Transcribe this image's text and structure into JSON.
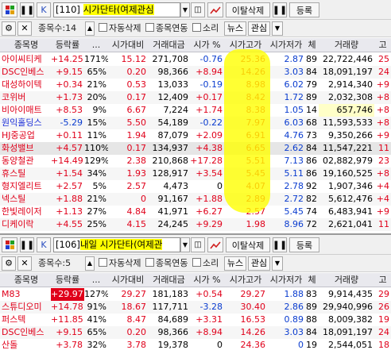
{
  "panel1": {
    "title_prefix": "[110] ",
    "title_highlight": "시가단타(여제관심",
    "title_suffix": "",
    "id_label": "K",
    "exit_delete": "이탈삭제",
    "register": "등록",
    "stock_count_label": "종목수:14",
    "auto_delete": "자동삭제",
    "stock_link": "종목연동",
    "sound": "소리",
    "news": "뉴스",
    "interest": "관심",
    "headers": [
      "종목명",
      "등락률",
      "...",
      "시가대비",
      "거래대금",
      "시가 %",
      "시가고가",
      "시가저가",
      "체",
      "거래량",
      "고"
    ],
    "rows": [
      {
        "name": "아이씨티케",
        "chg": "+14.25",
        "pct": "171%",
        "vsopen": "15.12",
        "amount": "271,708",
        "openpct": "-0.76",
        "hi": "25.36",
        "lo": "2.87",
        "c": "89",
        "vol": "22,722,446",
        "g": "25"
      },
      {
        "name": "DSC인베스",
        "chg": "+9.15",
        "pct": "65%",
        "vsopen": "0.20",
        "amount": "98,366",
        "openpct": "+8.94",
        "hi": "14.26",
        "lo": "3.03",
        "c": "84",
        "vol": "18,091,197",
        "g": "24"
      },
      {
        "name": "대성하이텍",
        "chg": "+0.34",
        "pct": "21%",
        "vsopen": "0.53",
        "amount": "13,033",
        "openpct": "-0.19",
        "hi": "8.98",
        "lo": "6.02",
        "c": "79",
        "vol": "2,914,340",
        "g": "+9"
      },
      {
        "name": "코위버",
        "chg": "+1.73",
        "pct": "20%",
        "vsopen": "0.17",
        "amount": "12,409",
        "openpct": "+0.17",
        "hi": "8.42",
        "lo": "1.72",
        "c": "89",
        "vol": "2,032,308",
        "g": "+8"
      },
      {
        "name": "비아이매트",
        "chg": "+8.53",
        "pct": "9%",
        "vsopen": "6.67",
        "amount": "7,224",
        "openpct": "+1.74",
        "hi": "8.38",
        "lo": "1.05",
        "c": "14",
        "vol": "657,746",
        "g": "+8"
      },
      {
        "name": "원익홀딩스",
        "chg": "-5.29",
        "pct": "15%",
        "vsopen": "5.50",
        "amount": "54,189",
        "openpct": "-0.22",
        "hi": "7.97",
        "lo": "6.03",
        "c": "68",
        "vol": "11,593,533",
        "g": "+8"
      },
      {
        "name": "HJ중공업",
        "chg": "+0.11",
        "pct": "11%",
        "vsopen": "1.94",
        "amount": "87,079",
        "openpct": "+2.09",
        "hi": "6.91",
        "lo": "4.76",
        "c": "73",
        "vol": "9,350,266",
        "g": "+9"
      },
      {
        "name": "화성밸브",
        "chg": "+4.57",
        "pct": "110%",
        "vsopen": "0.17",
        "amount": "134,937",
        "openpct": "+4.38",
        "hi": "6.65",
        "lo": "2.62",
        "c": "84",
        "vol": "11,547,221",
        "g": "11"
      },
      {
        "name": "동양철관",
        "chg": "+14.49",
        "pct": "129%",
        "vsopen": "2.38",
        "amount": "210,868",
        "openpct": "+17.28",
        "hi": "5.51",
        "lo": "7.13",
        "c": "86",
        "vol": "02,882,979",
        "g": "23"
      },
      {
        "name": "휴스틸",
        "chg": "+1.54",
        "pct": "34%",
        "vsopen": "1.93",
        "amount": "128,917",
        "openpct": "+3.54",
        "hi": "5.45",
        "lo": "5.11",
        "c": "86",
        "vol": "19,160,525",
        "g": "+8"
      },
      {
        "name": "형지엘리트",
        "chg": "+2.57",
        "pct": "5%",
        "vsopen": "2.57",
        "amount": "4,473",
        "openpct": "0",
        "hi": "4.07",
        "lo": "2.78",
        "c": "92",
        "vol": "1,907,346",
        "g": "+4"
      },
      {
        "name": "넥스틸",
        "chg": "+1.88",
        "pct": "21%",
        "vsopen": "0",
        "amount": "91,167",
        "openpct": "+1.88",
        "hi": "2.89",
        "lo": "2.72",
        "c": "82",
        "vol": "5,612,476",
        "g": "+4"
      },
      {
        "name": "한빛레이저",
        "chg": "+1.13",
        "pct": "27%",
        "vsopen": "4.84",
        "amount": "41,971",
        "openpct": "+6.27",
        "hi": "2.57",
        "lo": "5.45",
        "c": "74",
        "vol": "6,483,941",
        "g": "+9"
      },
      {
        "name": "디케이락",
        "chg": "+4.55",
        "pct": "25%",
        "vsopen": "4.15",
        "amount": "24,245",
        "openpct": "+9.29",
        "hi": "1.98",
        "lo": "8.96",
        "c": "72",
        "vol": "2,621,041",
        "g": "11"
      }
    ]
  },
  "panel2": {
    "title_prefix": "[106]",
    "title_highlight": "내일 시가단타(여제관",
    "id_label": "K",
    "exit_delete": "이탈삭제",
    "register": "등록",
    "stock_count_label": "종목수:5",
    "auto_delete": "자동삭제",
    "stock_link": "종목연동",
    "sound": "소리",
    "news": "뉴스",
    "interest": "관심",
    "headers": [
      "종목명",
      "등락률",
      "...",
      "시가대비",
      "거래대금",
      "시가 %",
      "시가고가",
      "시가저가",
      "체",
      "거래량",
      "고"
    ],
    "rows": [
      {
        "name": "M83",
        "chg": "+29.97",
        "pct": "127%",
        "vsopen": "29.27",
        "amount": "181,183",
        "openpct": "+0.54",
        "hi": "29.27",
        "lo": "1.88",
        "c": "83",
        "vol": "9,914,435",
        "g": "29"
      },
      {
        "name": "스튜디오미",
        "chg": "+14.78",
        "pct": "91%",
        "vsopen": "18.67",
        "amount": "117,711",
        "openpct": "-3.28",
        "hi": "30.40",
        "lo": "2.86",
        "c": "89",
        "vol": "29,940,996",
        "g": "26"
      },
      {
        "name": "퍼스텍",
        "chg": "+11.85",
        "pct": "41%",
        "vsopen": "8.47",
        "amount": "84,689",
        "openpct": "+3.31",
        "hi": "16.53",
        "lo": "0.89",
        "c": "88",
        "vol": "8,009,382",
        "g": "19"
      },
      {
        "name": "DSC인베스",
        "chg": "+9.15",
        "pct": "65%",
        "vsopen": "0.20",
        "amount": "98,366",
        "openpct": "+8.94",
        "hi": "14.26",
        "lo": "3.03",
        "c": "84",
        "vol": "18,091,197",
        "g": "24"
      },
      {
        "name": "산돌",
        "chg": "+3.78",
        "pct": "32%",
        "vsopen": "3.78",
        "amount": "19,378",
        "openpct": "0",
        "hi": "24.36",
        "lo": "0",
        "c": "19",
        "vol": "2,544,051",
        "g": "18"
      }
    ]
  }
}
